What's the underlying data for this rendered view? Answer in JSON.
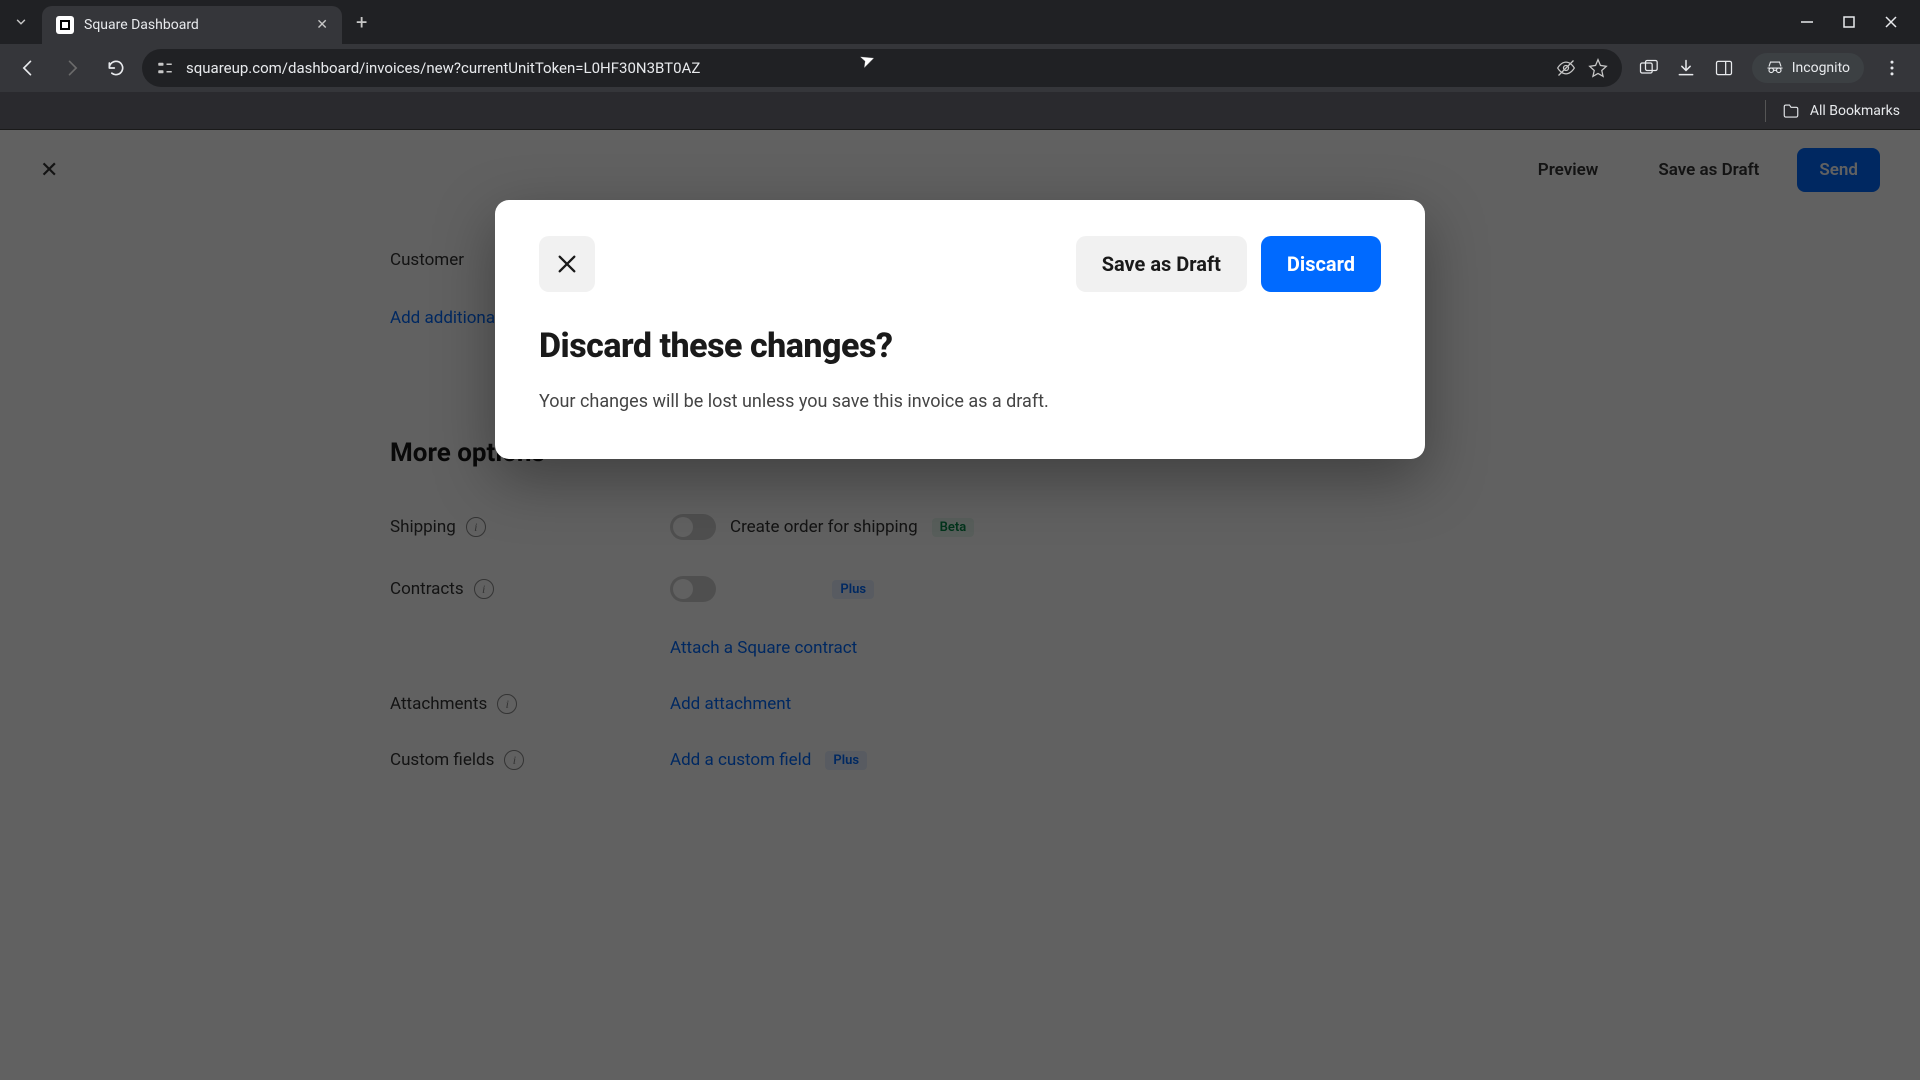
{
  "browser": {
    "tab_title": "Square Dashboard",
    "url": "squareup.com/dashboard/invoices/new?currentUnitToken=L0HF30N3BT0AZ",
    "incognito_label": "Incognito",
    "all_bookmarks": "All Bookmarks"
  },
  "page_header": {
    "preview": "Preview",
    "save_draft": "Save as Draft",
    "send": "Send"
  },
  "page": {
    "customer_label": "Customer",
    "add_additional": "Add additional",
    "more_options": "More options",
    "shipping": {
      "label": "Shipping",
      "toggle_label": "Create order for shipping",
      "badge": "Beta"
    },
    "contracts": {
      "label": "Contracts",
      "attach": "Attach a Square contract",
      "badge": "Plus"
    },
    "attachments": {
      "label": "Attachments",
      "action": "Add attachment"
    },
    "custom_fields": {
      "label": "Custom fields",
      "action": "Add a custom field",
      "badge": "Plus"
    }
  },
  "modal": {
    "save_draft": "Save as Draft",
    "discard": "Discard",
    "title": "Discard these changes?",
    "body": "Your changes will be lost unless you save this invoice as a draft."
  }
}
